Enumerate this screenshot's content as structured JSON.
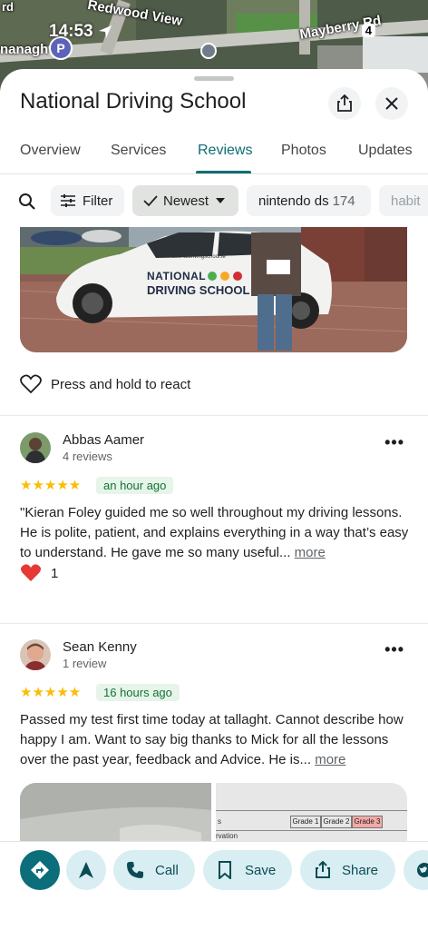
{
  "status": {
    "time": "14:53",
    "battery": "4"
  },
  "map": {
    "labels": [
      "Redwood View",
      "Mayberry Rd",
      "nanagh",
      "rd"
    ]
  },
  "header": {
    "title": "National Driving School",
    "share_icon": "share-icon",
    "close_icon": "close-icon"
  },
  "tabs": [
    {
      "label": "Overview",
      "active": false
    },
    {
      "label": "Services",
      "active": false
    },
    {
      "label": "Reviews",
      "active": true
    },
    {
      "label": "Photos",
      "active": false
    },
    {
      "label": "Updates",
      "active": false
    }
  ],
  "chips": {
    "filter_label": "Filter",
    "sort_label": "Newest",
    "topic1_label": "nintendo ds",
    "topic1_count": "174",
    "topic2_label": "habit"
  },
  "photo": {
    "car_text_line1": "NATIONAL",
    "car_text_line2": "DRIVING SCHOOL",
    "car_url": "www.nationaldrivingschool.ie"
  },
  "react": {
    "label": "Press and hold to react"
  },
  "reviews": [
    {
      "name": "Abbas Aamer",
      "sub": "4 reviews",
      "stars": "★★★★★",
      "time": "an hour ago",
      "text": "\"Kieran Foley guided me so well throughout my driving lessons. He is polite, patient, and explains everything in a way that’s easy to understand. He gave me so many useful...",
      "more": "more",
      "reaction_count": "1"
    },
    {
      "name": "Sean Kenny",
      "sub": "1 review",
      "stars": "★★★★★",
      "time": "16 hours ago",
      "text": "Passed my test first time today at tallaght. Cannot describe how happy I am. Want to say big thanks to Mick for all the lessons over the past year, feedback and Advice. He is...",
      "more": "more"
    }
  ],
  "review_photo": {
    "table_headers": [
      "Grade 1",
      "Grade 2",
      "Grade 3"
    ],
    "table_row_label": "rvation",
    "table_left_text": "s"
  },
  "actions": {
    "call": "Call",
    "save": "Save",
    "share": "Share"
  },
  "colors": {
    "accent": "#0b6e74",
    "star": "#fbbc04",
    "badge_bg": "#e6f4ea",
    "badge_text": "#137333",
    "action_bg": "#d8eef3"
  }
}
